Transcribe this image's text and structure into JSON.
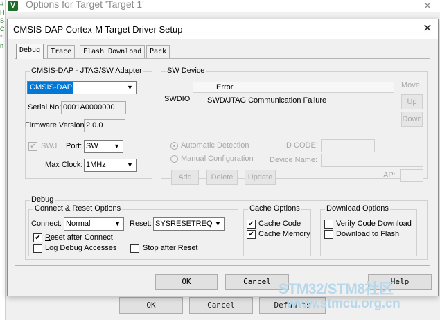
{
  "background_window": {
    "left_strip_chars": [
      "#",
      "H",
      "S",
      "C",
      "*",
      "",
      "n"
    ],
    "logo_letter": "V",
    "title": "Options for Target 'Target 1'",
    "close_glyph": "✕",
    "ok_label": "OK",
    "cancel_label": "Cancel",
    "defaults_label": "Defaults"
  },
  "dialog": {
    "title": "CMSIS-DAP Cortex-M Target Driver Setup",
    "close_glyph": "✕",
    "tabs": [
      {
        "label": "Debug",
        "active": true
      },
      {
        "label": "Trace",
        "active": false
      },
      {
        "label": "Flash Download",
        "active": false
      },
      {
        "label": "Pack",
        "active": false
      }
    ],
    "adapter": {
      "group_label": "CMSIS-DAP - JTAG/SW Adapter",
      "selected": "CMSIS-DAP",
      "serial_label": "Serial No:",
      "serial_value": "0001A0000000",
      "firmware_label": "Firmware Version:",
      "firmware_value": "2.0.0",
      "swj_label": "SWJ",
      "swj_checked": true,
      "port_label": "Port:",
      "port_value": "SW",
      "clock_label": "Max Clock:",
      "clock_value": "1MHz"
    },
    "sw_device": {
      "group_label": "SW Device",
      "row_label": "SWDIO",
      "column_header": "Error",
      "message": "SWD/JTAG Communication Failure",
      "move_label": "Move",
      "up_label": "Up",
      "down_label": "Down",
      "auto_detect_label": "Automatic Detection",
      "manual_config_label": "Manual Configuration",
      "id_code_label": "ID CODE:",
      "device_name_label": "Device Name:",
      "add_label": "Add",
      "delete_label": "Delete",
      "update_label": "Update",
      "ap_label": "AP:"
    },
    "debug": {
      "group_label": "Debug",
      "connect_reset": {
        "group_label": "Connect & Reset Options",
        "connect_label": "Connect:",
        "connect_value": "Normal",
        "reset_label": "Reset:",
        "reset_value": "SYSRESETREQ",
        "reset_after_connect_label": "Reset after Connect",
        "reset_after_connect_checked": true,
        "log_debug_label": "Log Debug Accesses",
        "log_debug_checked": false,
        "stop_after_reset_label": "Stop after Reset",
        "stop_after_reset_checked": false
      },
      "cache": {
        "group_label": "Cache Options",
        "cache_code_label": "Cache Code",
        "cache_code_checked": true,
        "cache_memory_label": "Cache Memory",
        "cache_memory_checked": true
      },
      "download": {
        "group_label": "Download Options",
        "verify_label": "Verify Code Download",
        "verify_checked": false,
        "download_flash_label": "Download to Flash",
        "download_flash_checked": false
      }
    },
    "ok_label": "OK",
    "cancel_label": "Cancel",
    "help_label": "Help"
  },
  "watermark": {
    "line1": "STM32/STM8社区",
    "line2": "www.stmcu.org.cn"
  },
  "icons": {
    "dropdown": "chevron-down-icon",
    "checkmark": "checkmark-icon",
    "close": "close-icon"
  }
}
